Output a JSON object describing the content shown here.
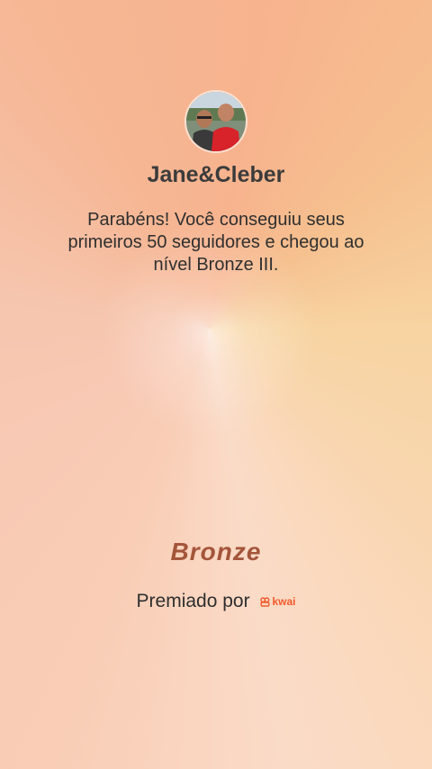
{
  "profile": {
    "name": "Jane&Cleber"
  },
  "achievement": {
    "message": "Parabéns! Você conseguiu seus primeiros 50 seguidores e chegou ao nível Bronze III.",
    "level_label": "Bronze"
  },
  "footer": {
    "awarded_by": "Premiado por",
    "brand": "kwai"
  },
  "colors": {
    "level_text": "#a4553a",
    "brand": "#f25a2c"
  }
}
